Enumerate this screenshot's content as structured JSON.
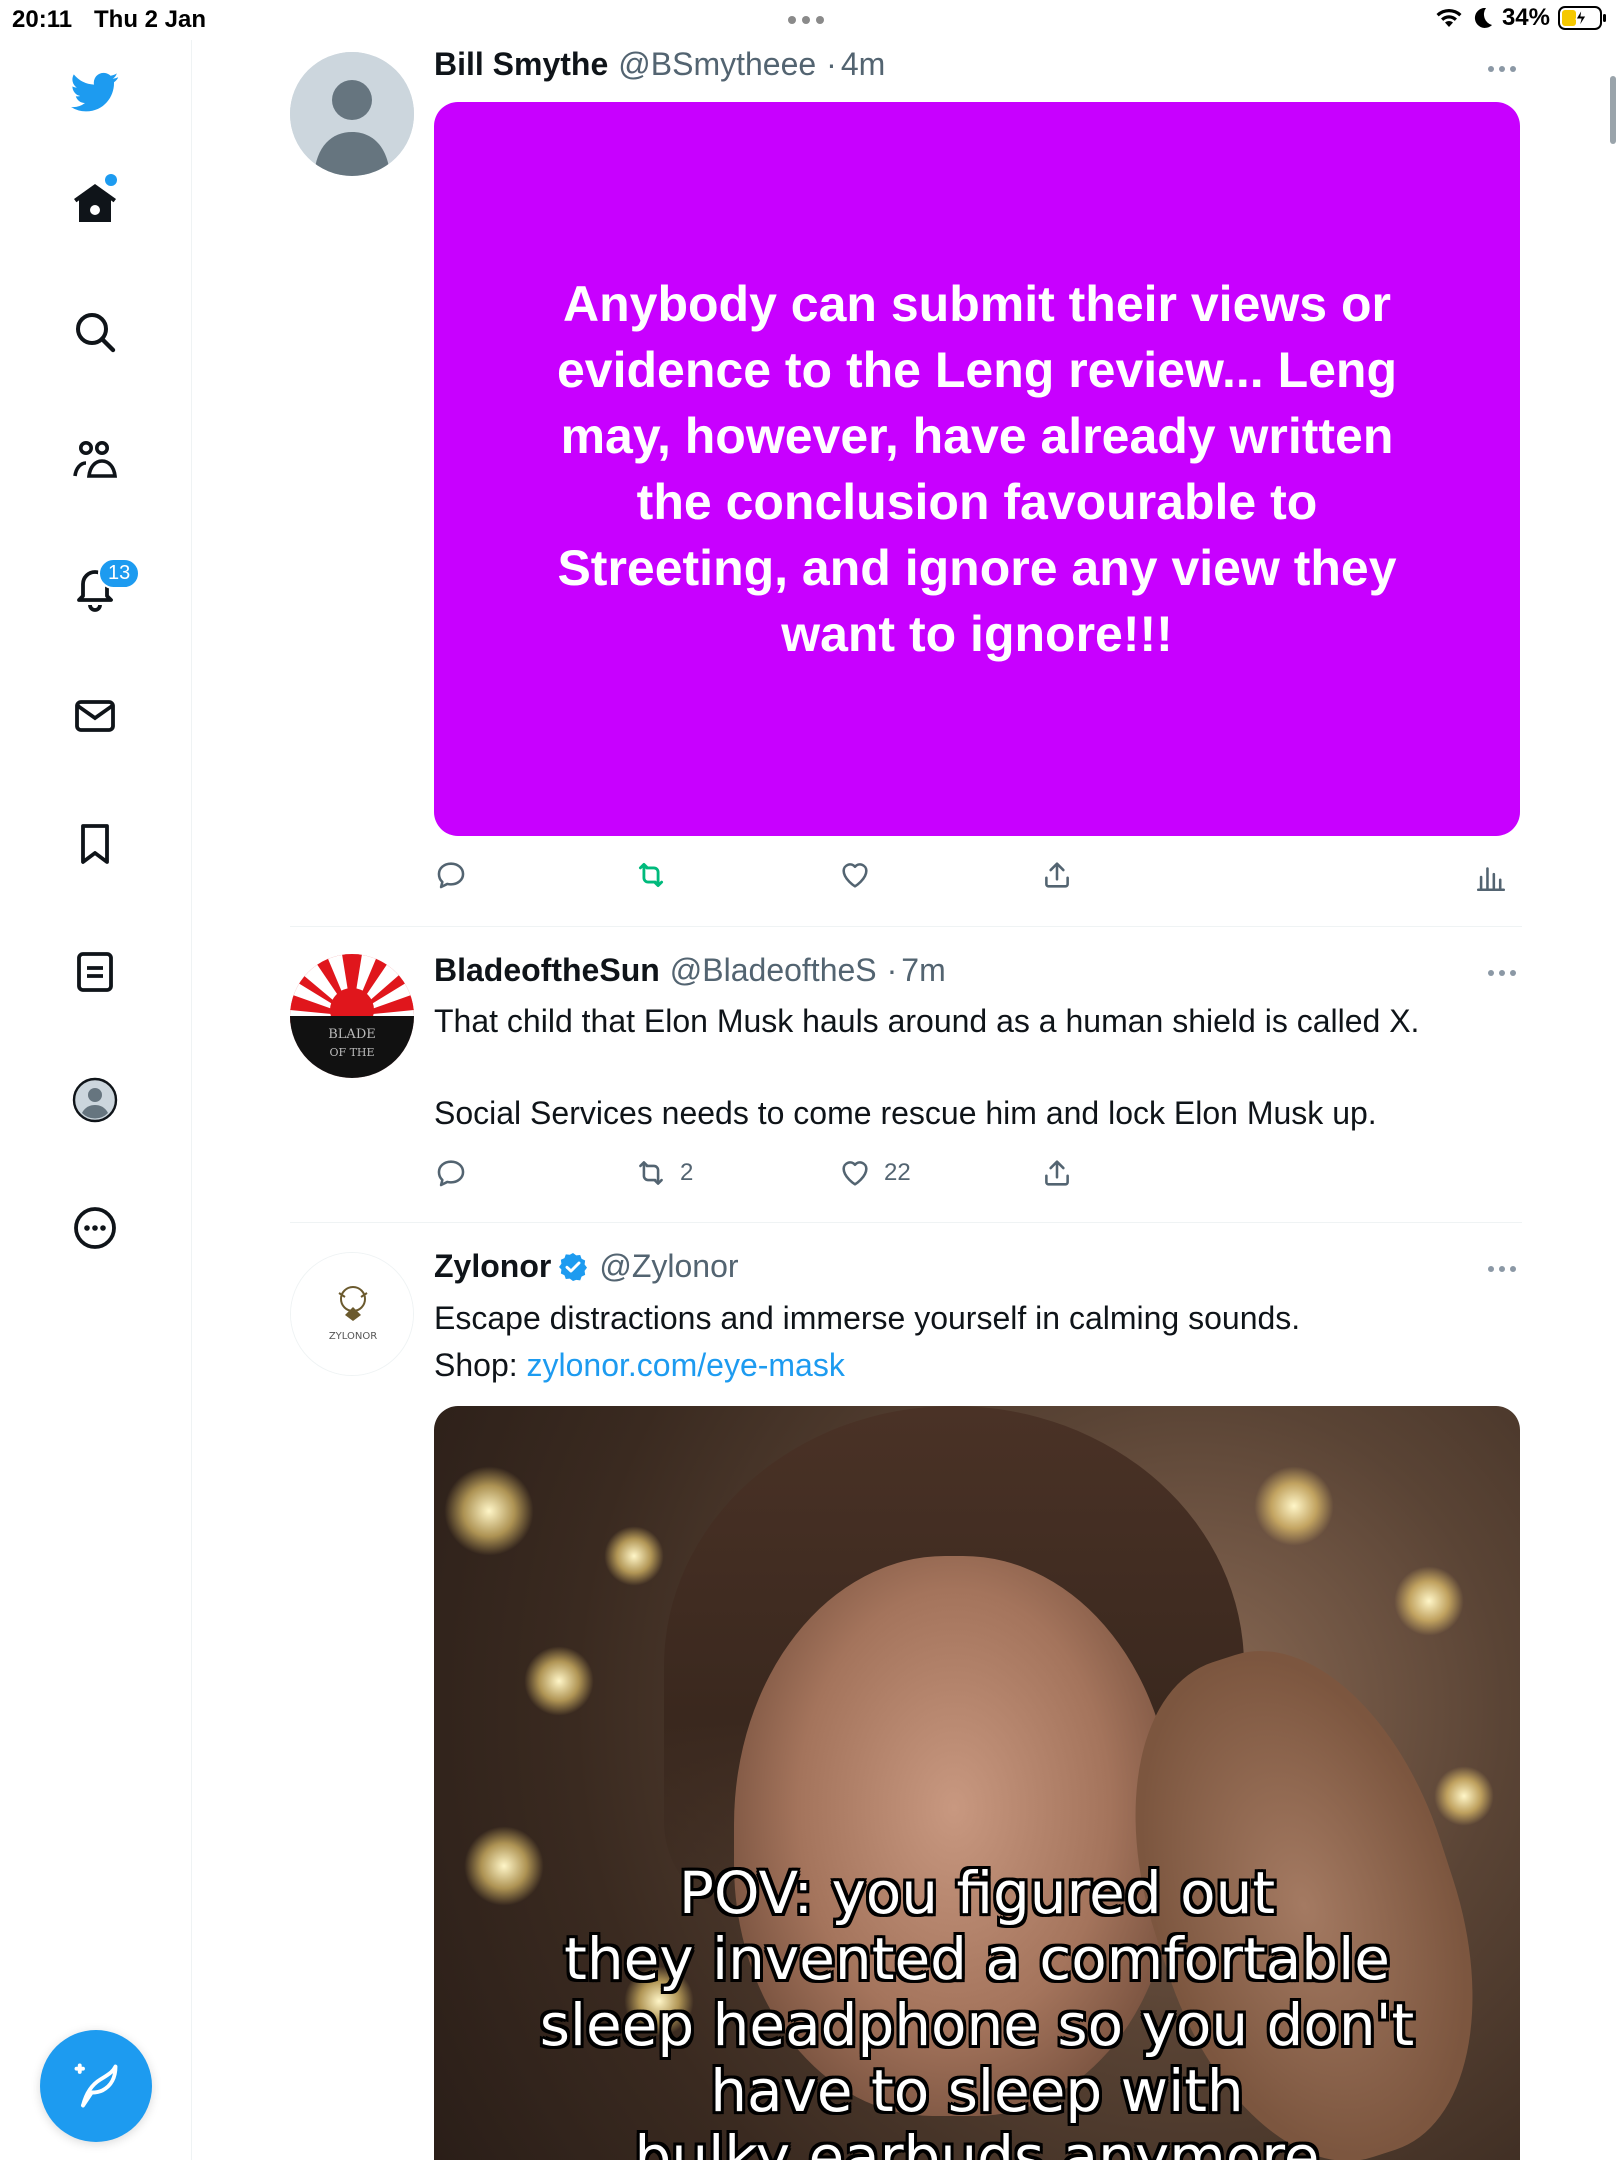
{
  "status_bar": {
    "time": "20:11",
    "date": "Thu 2 Jan",
    "battery": "34%"
  },
  "sidebar": {
    "items": [
      {
        "name": "twitter-logo-icon"
      },
      {
        "name": "home-icon"
      },
      {
        "name": "search-icon"
      },
      {
        "name": "communities-icon"
      },
      {
        "name": "notifications-icon",
        "badge": "13"
      },
      {
        "name": "messages-icon"
      },
      {
        "name": "bookmarks-icon"
      },
      {
        "name": "lists-icon"
      },
      {
        "name": "profile-icon"
      },
      {
        "name": "more-icon"
      }
    ],
    "notifications_badge": "13",
    "accent": "#1d9bf0"
  },
  "tweets": [
    {
      "name": "Bill Smythe",
      "handle": "@BSmytheee",
      "sep": "·",
      "time": "4m",
      "media_text": "Anybody can submit their views or evidence to the Leng review... Leng may, however, have already written the conclusion favourable to Streeting, and ignore any view they want to ignore!!!",
      "media_color": "#c800ff",
      "retweeted": true
    },
    {
      "name": "BladeoftheSun",
      "handle": "@BladeoftheS",
      "sep": "·",
      "time": "7m",
      "text_line1": "That child that Elon Musk hauls around as a human shield is called X.",
      "text_line2": "Social Services needs to come rescue him and lock Elon Musk up.",
      "retweets": "2",
      "likes": "22",
      "avatar_text_1": "BLADE",
      "avatar_text_2": "OF THE"
    },
    {
      "name": "Zylonor",
      "handle": "@Zylonor",
      "verified": true,
      "text_line1": "Escape distractions and immerse yourself in calming sounds.",
      "text_shop": "Shop: ",
      "link": "zylonor.com/eye-mask",
      "avatar_text": "ZYLONOR",
      "meme_lines": [
        "POV: you figured out",
        "they invented a comfortable",
        "sleep headphone so you don't",
        "have to sleep with",
        "bulky earbuds anymore"
      ]
    }
  ]
}
